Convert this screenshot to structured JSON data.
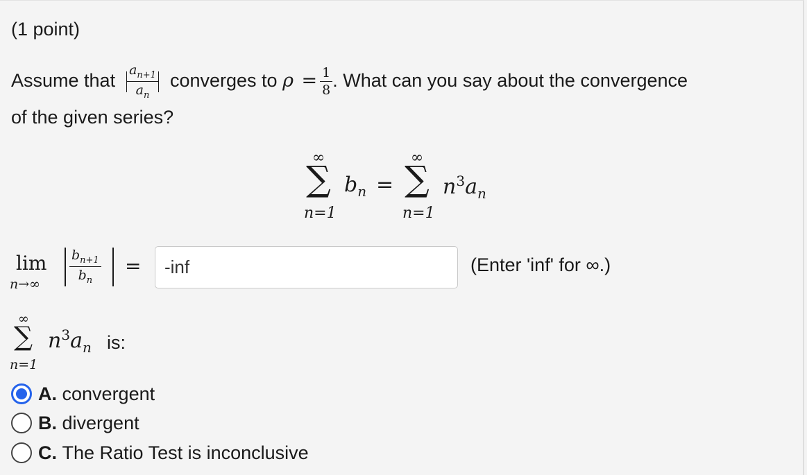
{
  "points_label": "(1 point)",
  "question": {
    "prefix": "Assume that",
    "ratio_num": "a",
    "ratio_num_sub": "n+1",
    "ratio_den": "a",
    "ratio_den_sub": "n",
    "middle": "converges to",
    "rho": "ρ",
    "equals": "=",
    "rho_num": "1",
    "rho_den": "8",
    "suffix": ". What can you say about the convergence",
    "line2": "of the given series?"
  },
  "series_display": {
    "sum_top": "∞",
    "sum_symbol": "∑",
    "sum_bottom": "n=1",
    "lhs_term": "b",
    "lhs_sub": "n",
    "equals": "=",
    "rhs_base": "n",
    "rhs_exp": "3",
    "rhs_a": "a",
    "rhs_sub": "n"
  },
  "limit": {
    "lim": "lim",
    "under": "n→∞",
    "num": "b",
    "num_sub": "n+1",
    "den": "b",
    "den_sub": "n",
    "equals": "="
  },
  "answer_input": {
    "value": "-inf",
    "placeholder": ""
  },
  "hint": "(Enter 'inf' for ∞.)",
  "series_question": {
    "top": "∞",
    "symbol": "∑",
    "bottom": "n=1",
    "base": "n",
    "exp": "3",
    "a": "a",
    "sub": "n",
    "suffix": "is:"
  },
  "options": [
    {
      "letter": "A.",
      "text": "convergent",
      "selected": true
    },
    {
      "letter": "B.",
      "text": "divergent",
      "selected": false
    },
    {
      "letter": "C.",
      "text": "The Ratio Test is inconclusive",
      "selected": false
    }
  ],
  "colors": {
    "accent": "#2563eb",
    "background": "#f4f4f4"
  }
}
